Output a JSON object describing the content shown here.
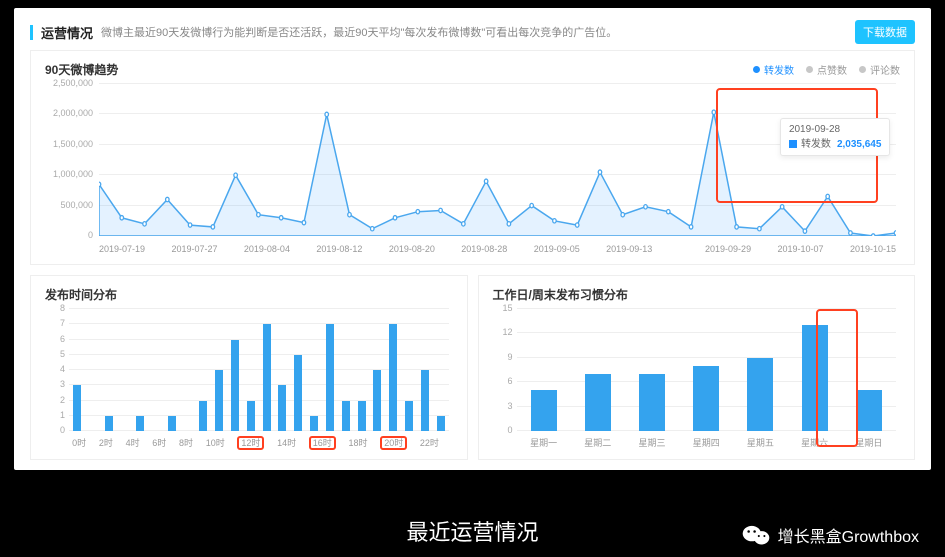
{
  "header": {
    "title": "运营情况",
    "subtitle": "微博主最近90天发微博行为能判断是否还活跃，最近90天平均\"每次发布微博数\"可看出每次竞争的广告位。",
    "download": "下载数据"
  },
  "trend": {
    "title": "90天微博趋势",
    "legend_active": "转发数",
    "legend_like": "点赞数",
    "legend_comment": "评论数",
    "tooltip_date": "2019-09-28",
    "tooltip_label": "转发数",
    "tooltip_value": "2,035,645"
  },
  "hourly": {
    "title": "发布时间分布"
  },
  "weekly": {
    "title": "工作日/周末发布习惯分布"
  },
  "footer": {
    "caption": "最近运营情况",
    "brand": "增长黑盒Growthbox"
  },
  "chart_data": [
    {
      "type": "area",
      "id": "trend90",
      "ylim": [
        0,
        2500000
      ],
      "yticks": [
        0,
        500000,
        1000000,
        1500000,
        2000000,
        2500000
      ],
      "x_labels": [
        "2019-07-19",
        "2019-07-27",
        "2019-08-04",
        "2019-08-12",
        "2019-08-20",
        "2019-08-28",
        "2019-09-05",
        "2019-09-13",
        "",
        "2019-09-29",
        "2019-10-07",
        "2019-10-15"
      ],
      "values": [
        850000,
        300000,
        200000,
        600000,
        180000,
        150000,
        1000000,
        350000,
        300000,
        220000,
        2000000,
        350000,
        120000,
        300000,
        400000,
        420000,
        200000,
        900000,
        200000,
        500000,
        250000,
        180000,
        1050000,
        350000,
        480000,
        400000,
        150000,
        2035645,
        150000,
        120000,
        480000,
        80000,
        650000,
        50000,
        0,
        50000
      ],
      "tooltip": {
        "date": "2019-09-28",
        "label": "转发数",
        "value": 2035645
      },
      "highlight_index": 27
    },
    {
      "type": "bar",
      "id": "hourly",
      "categories": [
        "0时",
        "",
        "2时",
        "",
        "4时",
        "",
        "6时",
        "",
        "8时",
        "",
        "10时",
        "",
        "12时",
        "",
        "14时",
        "",
        "16时",
        "",
        "18时",
        "",
        "20时",
        "",
        "22时",
        ""
      ],
      "values": [
        3,
        0,
        1,
        0,
        1,
        0,
        1,
        0,
        2,
        4,
        6,
        2,
        7,
        3,
        5,
        1,
        7,
        2,
        2,
        4,
        7,
        2,
        4,
        1
      ],
      "ylim": [
        0,
        8
      ],
      "yticks": [
        0,
        1,
        2,
        3,
        4,
        5,
        6,
        7,
        8
      ],
      "highlight_hours": [
        "12时",
        "16时",
        "20时"
      ]
    },
    {
      "type": "bar",
      "id": "weekly",
      "categories": [
        "星期一",
        "星期二",
        "星期三",
        "星期四",
        "星期五",
        "星期六",
        "星期日"
      ],
      "values": [
        5,
        7,
        7,
        8,
        9,
        13,
        5
      ],
      "ylim": [
        0,
        15
      ],
      "yticks": [
        0,
        3,
        6,
        9,
        12,
        15
      ],
      "highlight_category": "星期六"
    }
  ]
}
